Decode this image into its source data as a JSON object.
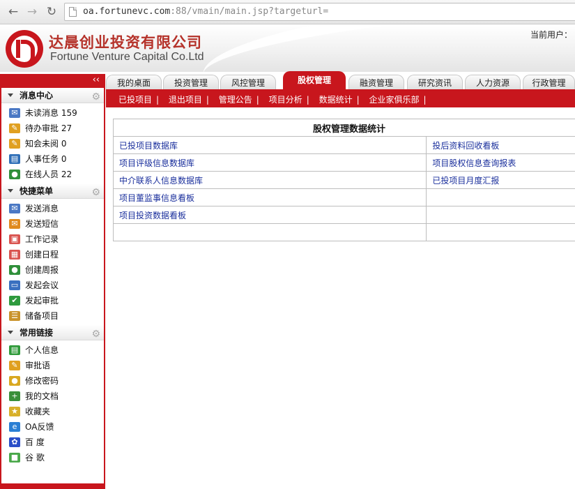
{
  "browser": {
    "url_host": "oa.fortunevc.com",
    "url_rest": ":88/vmain/main.jsp?targeturl="
  },
  "header": {
    "company_cn": "达晨创业投资有限公司",
    "company_en": "Fortune Venture Capital Co.Ltd",
    "current_user": "当前用户："
  },
  "tabs": [
    {
      "label": "我的桌面"
    },
    {
      "label": "投资管理"
    },
    {
      "label": "风控管理"
    },
    {
      "label": "股权管理",
      "active": true
    },
    {
      "label": "融资管理"
    },
    {
      "label": "研究资讯"
    },
    {
      "label": "人力资源"
    },
    {
      "label": "行政管理"
    }
  ],
  "subnav": [
    "已投项目",
    "退出项目",
    "管理公告",
    "项目分析",
    "数据统计",
    "企业家俱乐部"
  ],
  "sidebar": {
    "collapse": "‹‹",
    "sections": [
      {
        "title": "消息中心",
        "items": [
          {
            "label": "未读消息 159",
            "icon": "envelope-icon",
            "color": "#4a78c4"
          },
          {
            "label": "待办审批 27",
            "icon": "edit-note-icon",
            "color": "#e0a020"
          },
          {
            "label": "知会未阅 0",
            "icon": "edit-note-icon",
            "color": "#e0a020"
          },
          {
            "label": "人事任务 0",
            "icon": "contact-card-icon",
            "color": "#2f6fb8"
          },
          {
            "label": "在线人员 22",
            "icon": "user-icon",
            "color": "#2f8f3a"
          }
        ]
      },
      {
        "title": "快捷菜单",
        "items": [
          {
            "label": "发送消息",
            "icon": "envelope-icon",
            "color": "#4a78c4"
          },
          {
            "label": "发送短信",
            "icon": "envelope-orange-icon",
            "color": "#e08a1e"
          },
          {
            "label": "工作记录",
            "icon": "document-icon",
            "color": "#d9534f"
          },
          {
            "label": "创建日程",
            "icon": "calendar-icon",
            "color": "#d9534f"
          },
          {
            "label": "创建周报",
            "icon": "user-icon",
            "color": "#2f8f3a"
          },
          {
            "label": "发起会议",
            "icon": "window-icon",
            "color": "#3a70c0"
          },
          {
            "label": "发起审批",
            "icon": "approval-icon",
            "color": "#2e9a3e"
          },
          {
            "label": "储备项目",
            "icon": "list-edit-icon",
            "color": "#c9932b"
          }
        ]
      },
      {
        "title": "常用链接",
        "items": [
          {
            "label": "个人信息",
            "icon": "id-card-icon",
            "color": "#2f9a3a"
          },
          {
            "label": "审批语",
            "icon": "edit-note-icon",
            "color": "#e0a020"
          },
          {
            "label": "修改密码",
            "icon": "lock-icon",
            "color": "#d9a820"
          },
          {
            "label": "我的文档",
            "icon": "document-add-icon",
            "color": "#3a8f3a"
          },
          {
            "label": "收藏夹",
            "icon": "folder-star-icon",
            "color": "#d8b02a"
          },
          {
            "label": "OA反馈",
            "icon": "browser-e-icon",
            "color": "#2a7fd4"
          },
          {
            "label": "百 度",
            "icon": "paw-icon",
            "color": "#2a4fc8"
          },
          {
            "label": "谷 歌",
            "icon": "google-icon",
            "color": "#4aa84a"
          }
        ]
      }
    ]
  },
  "stats": {
    "title": "股权管理数据统计",
    "rows": [
      [
        "已投项目数据库",
        "投后资料回收看板"
      ],
      [
        "项目评级信息数据库",
        "项目股权信息查询报表"
      ],
      [
        "中介联系人信息数据库",
        "已投项目月度汇报"
      ],
      [
        "项目董监事信息看板",
        ""
      ],
      [
        "项目投资数据看板",
        ""
      ],
      [
        "",
        ""
      ]
    ]
  }
}
